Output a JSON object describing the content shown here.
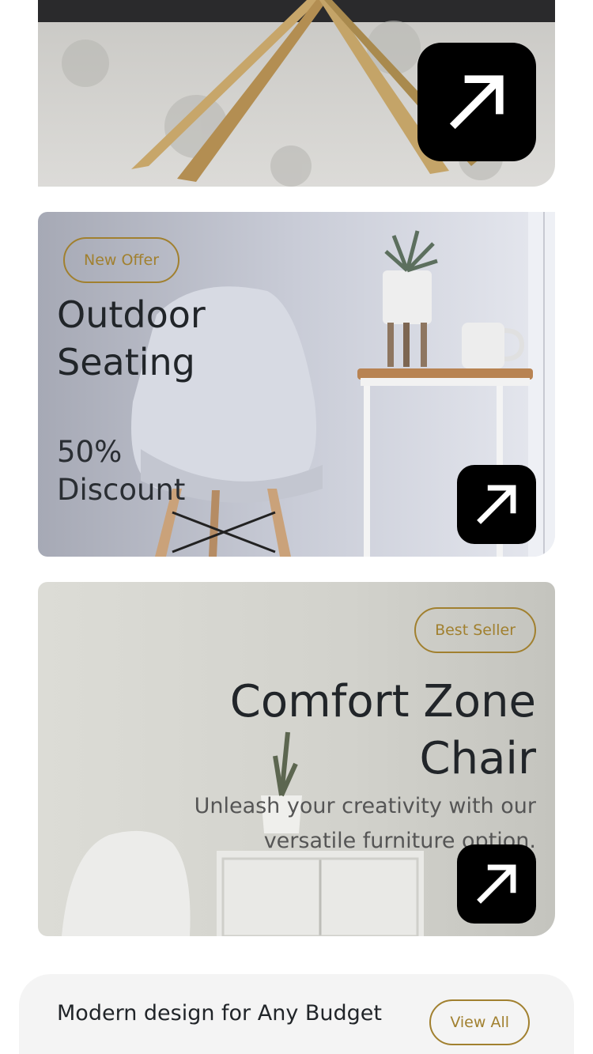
{
  "cards": [
    {
      "id": "chair-legs",
      "icon": "arrow-up-right-icon"
    },
    {
      "id": "outdoor-seating",
      "badge": "New Offer",
      "title": "Outdoor Seating",
      "discount": "50% Discount",
      "icon": "arrow-up-right-icon"
    },
    {
      "id": "comfort-zone",
      "badge": "Best Seller",
      "title": "Comfort Zone Chair",
      "subtitle": "Unleash your creativity with our versatile furniture option.",
      "icon": "arrow-up-right-icon"
    }
  ],
  "section": {
    "title": "Modern design for Any Budget",
    "view_all": "View All"
  },
  "colors": {
    "accent": "#a1802f",
    "button_bg": "#000000",
    "text": "#212529",
    "footer_bg": "#f4f4f4"
  }
}
